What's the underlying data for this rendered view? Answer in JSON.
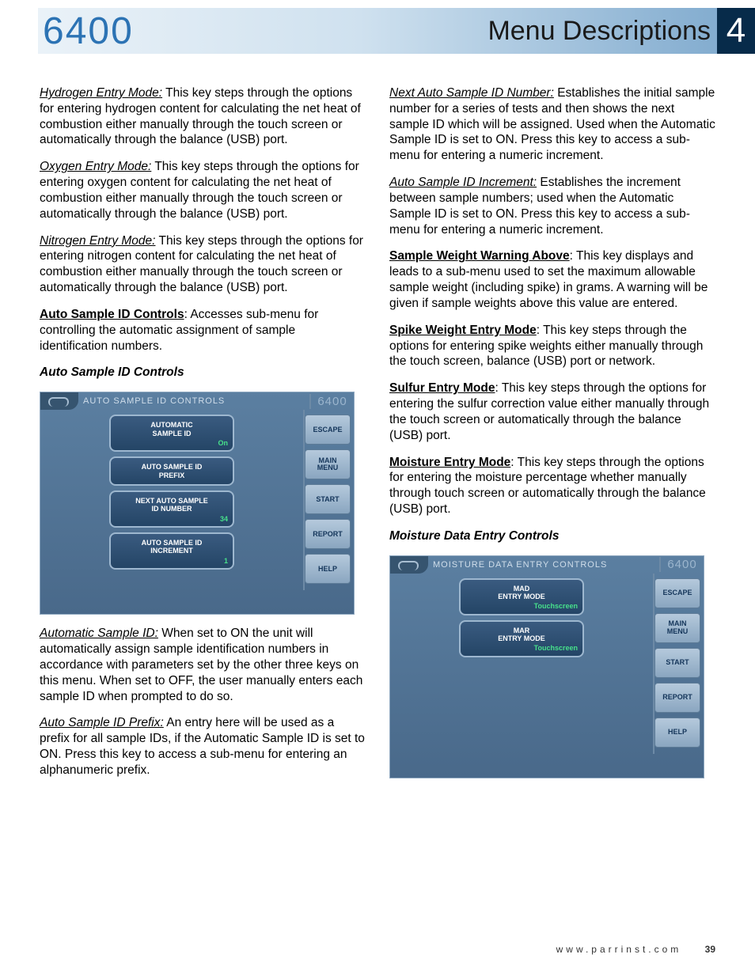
{
  "header": {
    "model": "6400",
    "menu_desc": "Menu Descriptions",
    "chapter": "4"
  },
  "footer": {
    "url": "www.parrinst.com",
    "page": "39"
  },
  "left_col": {
    "hydrogen": {
      "term": "Hydrogen Entry Mode:",
      "body": " This key steps through the options for entering hydrogen content for calculating the net heat of combustion either manually through the touch screen or automatically through the balance (USB) port."
    },
    "oxygen": {
      "term": "Oxygen Entry Mode:",
      "body": " This key steps through the options for entering oxygen content for calculating the net heat of combustion either manually through the touch screen or automatically through the balance (USB) port."
    },
    "nitrogen": {
      "term": "Nitrogen Entry Mode:",
      "body": " This key steps through the options for entering nitrogen content for calculating the net heat of combustion either manually through the touch screen or automatically through the balance (USB) port."
    },
    "auto_sample_id_controls_hdr": {
      "term": "Auto Sample ID Controls",
      "body": ":  Accesses sub-menu for controlling the automatic assignment of sample identification numbers."
    },
    "screen1_caption": "Auto Sample ID Controls",
    "auto_sample_id": {
      "term": "Automatic Sample ID:",
      "body": "  When set to ON the unit will automatically assign sample identification numbers in accordance with parameters set by the other three keys on this menu.  When set to OFF, the user manually enters each sample ID when prompted to do so."
    },
    "prefix": {
      "term": "Auto Sample ID Prefix:",
      "body": "  An entry here will be used as a prefix for all sample IDs, if the Automatic Sample ID is set to ON.  Press this key to access a sub-menu for entering an alphanumeric prefix."
    }
  },
  "right_col": {
    "next_id": {
      "term": "Next Auto Sample ID Number:",
      "body": "  Establishes the initial sample number for a series of tests and then shows the next sample ID which will be assigned.  Used when the Automatic Sample ID is set to ON.  Press this key to access a sub-menu for entering a numeric increment."
    },
    "increment": {
      "term": "Auto Sample ID Increment:",
      "body": "  Establishes the increment between sample numbers; used when the Automatic Sample ID is set to ON.  Press this key to access a sub-menu for entering a numeric increment."
    },
    "weight_warn": {
      "term": "Sample Weight Warning Above",
      "body": ":  This key displays and leads to a sub-menu used to set the maximum allowable sample weight (including spike) in grams.  A warning will be given if sample weights above this value are entered."
    },
    "spike": {
      "term": "Spike Weight Entry Mode",
      "body": ":  This key steps through the options for entering spike weights either manually through the touch screen, balance (USB) port or network."
    },
    "sulfur": {
      "term": "Sulfur Entry Mode",
      "body": ":  This key steps through the options for entering the sulfur correction value either manually through the touch screen or automatically through the balance (USB) port."
    },
    "moisture": {
      "term": "Moisture Entry Mode",
      "body": ":  This key steps through the options for entering the moisture percentage whether manually through touch screen or automatically through the balance (USB) port."
    },
    "screen2_caption": "Moisture Data Entry Controls"
  },
  "screen1": {
    "title": "AUTO SAMPLE ID CONTROLS",
    "model": "6400",
    "buttons": [
      {
        "label_l1": "AUTOMATIC",
        "label_l2": "SAMPLE ID",
        "value": "On"
      },
      {
        "label_l1": "AUTO SAMPLE ID",
        "label_l2": "PREFIX",
        "value": ""
      },
      {
        "label_l1": "NEXT AUTO SAMPLE",
        "label_l2": "ID NUMBER",
        "value": "34"
      },
      {
        "label_l1": "AUTO SAMPLE ID",
        "label_l2": "INCREMENT",
        "value": "1"
      }
    ],
    "side": [
      "ESCAPE",
      "MAIN\nMENU",
      "START",
      "REPORT",
      "HELP"
    ]
  },
  "screen2": {
    "title": "MOISTURE DATA ENTRY CONTROLS",
    "model": "6400",
    "buttons": [
      {
        "label_l1": "MAD",
        "label_l2": "ENTRY MODE",
        "value": "Touchscreen"
      },
      {
        "label_l1": "MAR",
        "label_l2": "ENTRY MODE",
        "value": "Touchscreen"
      }
    ],
    "side": [
      "ESCAPE",
      "MAIN\nMENU",
      "START",
      "REPORT",
      "HELP"
    ]
  }
}
